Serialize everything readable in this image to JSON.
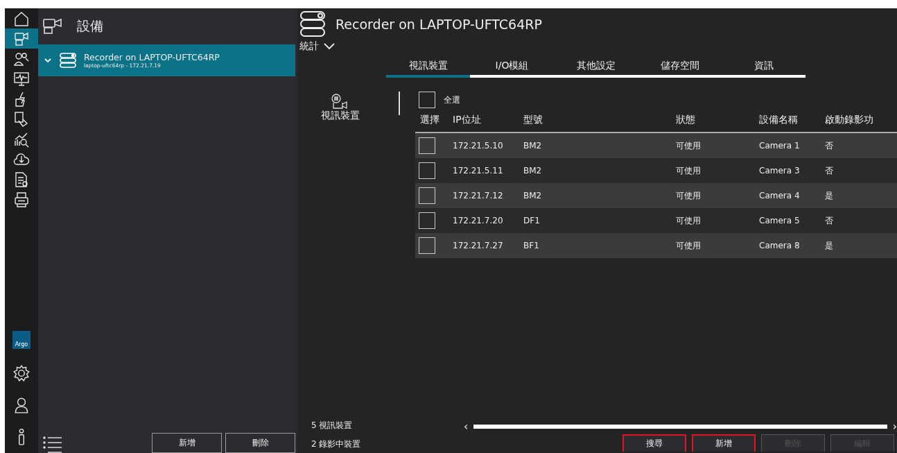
{
  "rail": {
    "items": [
      {
        "selected": false
      },
      {
        "selected": true
      },
      {
        "selected": false
      },
      {
        "selected": false
      },
      {
        "selected": false
      },
      {
        "selected": false
      },
      {
        "selected": false
      },
      {
        "selected": false
      },
      {
        "selected": false
      },
      {
        "selected": false
      }
    ],
    "logo_text": "Argo",
    "bottom_items": [
      {
        "selected": false
      },
      {
        "selected": false
      },
      {
        "selected": false
      }
    ]
  },
  "left_panel": {
    "title": "設備",
    "tree": [
      {
        "title": "Recorder on LAPTOP-UFTC64RP",
        "subtitle": "laptop-uftc64rp - 172.21.7.19",
        "expanded": true,
        "selected": true
      }
    ],
    "buttons": [
      {
        "label": "新增"
      },
      {
        "label": "刪除"
      }
    ]
  },
  "main": {
    "title": "Recorder on LAPTOP-UFTC64RP",
    "stats_label": "統計",
    "tabs": [
      {
        "label": "視訊裝置",
        "selected": true
      },
      {
        "label": "I/O模組",
        "selected": false
      },
      {
        "label": "其他設定",
        "selected": false
      },
      {
        "label": "儲存空間",
        "selected": false
      },
      {
        "label": "資訊",
        "selected": false
      }
    ],
    "section_label": "視訊裝置",
    "select_all": {
      "label": "全選",
      "checked": false
    },
    "table": {
      "columns": [
        "選擇",
        "IP位址",
        "型號",
        "狀態",
        "設備名稱",
        "啟動錄影功"
      ],
      "rows": [
        {
          "checked": false,
          "cells": [
            "",
            "172.21.5.10",
            "BM2",
            "可使用",
            "Camera 1",
            "否"
          ]
        },
        {
          "checked": false,
          "cells": [
            "",
            "172.21.5.11",
            "BM2",
            "可使用",
            "Camera 3",
            "否"
          ]
        },
        {
          "checked": false,
          "cells": [
            "",
            "172.21.7.12",
            "BM2",
            "可使用",
            "Camera 4",
            "是"
          ]
        },
        {
          "checked": false,
          "cells": [
            "",
            "172.21.7.20",
            "DF1",
            "可使用",
            "Camera 5",
            "否"
          ]
        },
        {
          "checked": false,
          "cells": [
            "",
            "172.21.7.27",
            "BF1",
            "可使用",
            "Camera 8",
            "是"
          ]
        }
      ]
    },
    "status": [
      "5 視訊裝置",
      "2 錄影中裝置"
    ],
    "scroll_left": "‹",
    "scroll_right": "›",
    "buttons": [
      {
        "label": "搜尋",
        "disabled": false,
        "highlighted": true
      },
      {
        "label": "新增",
        "disabled": false,
        "highlighted": true
      },
      {
        "label": "刪除",
        "disabled": true,
        "highlighted": false
      },
      {
        "label": "編輯",
        "disabled": true,
        "highlighted": false
      }
    ]
  }
}
